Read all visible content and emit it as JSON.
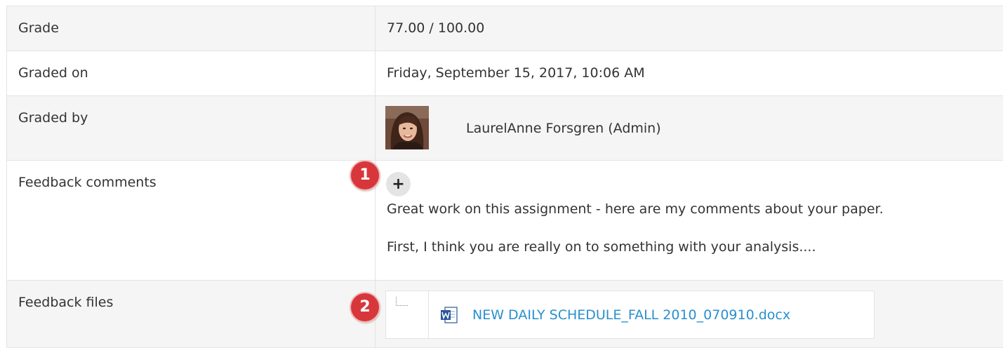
{
  "rows": {
    "grade": {
      "label": "Grade",
      "value": "77.00 / 100.00"
    },
    "graded_on": {
      "label": "Graded on",
      "value": "Friday, September 15, 2017, 10:06 AM"
    },
    "graded_by": {
      "label": "Graded by",
      "name": "LaurelAnne Forsgren (Admin)"
    },
    "feedback_comments": {
      "label": "Feedback comments",
      "expand_label": "+",
      "paragraphs": [
        "Great work on this assignment - here are my comments about your paper.",
        "First, I think you are really on to something with your analysis...."
      ]
    },
    "feedback_files": {
      "label": "Feedback files",
      "file_name": "NEW DAILY SCHEDULE_FALL 2010_070910.docx",
      "file_icon": "word-document-icon"
    }
  },
  "markers": [
    "1",
    "2"
  ],
  "colors": {
    "marker": "#d7373b",
    "link": "#2a8fcf",
    "row_shade": "#f5f5f5",
    "border": "#e3e3e3"
  }
}
